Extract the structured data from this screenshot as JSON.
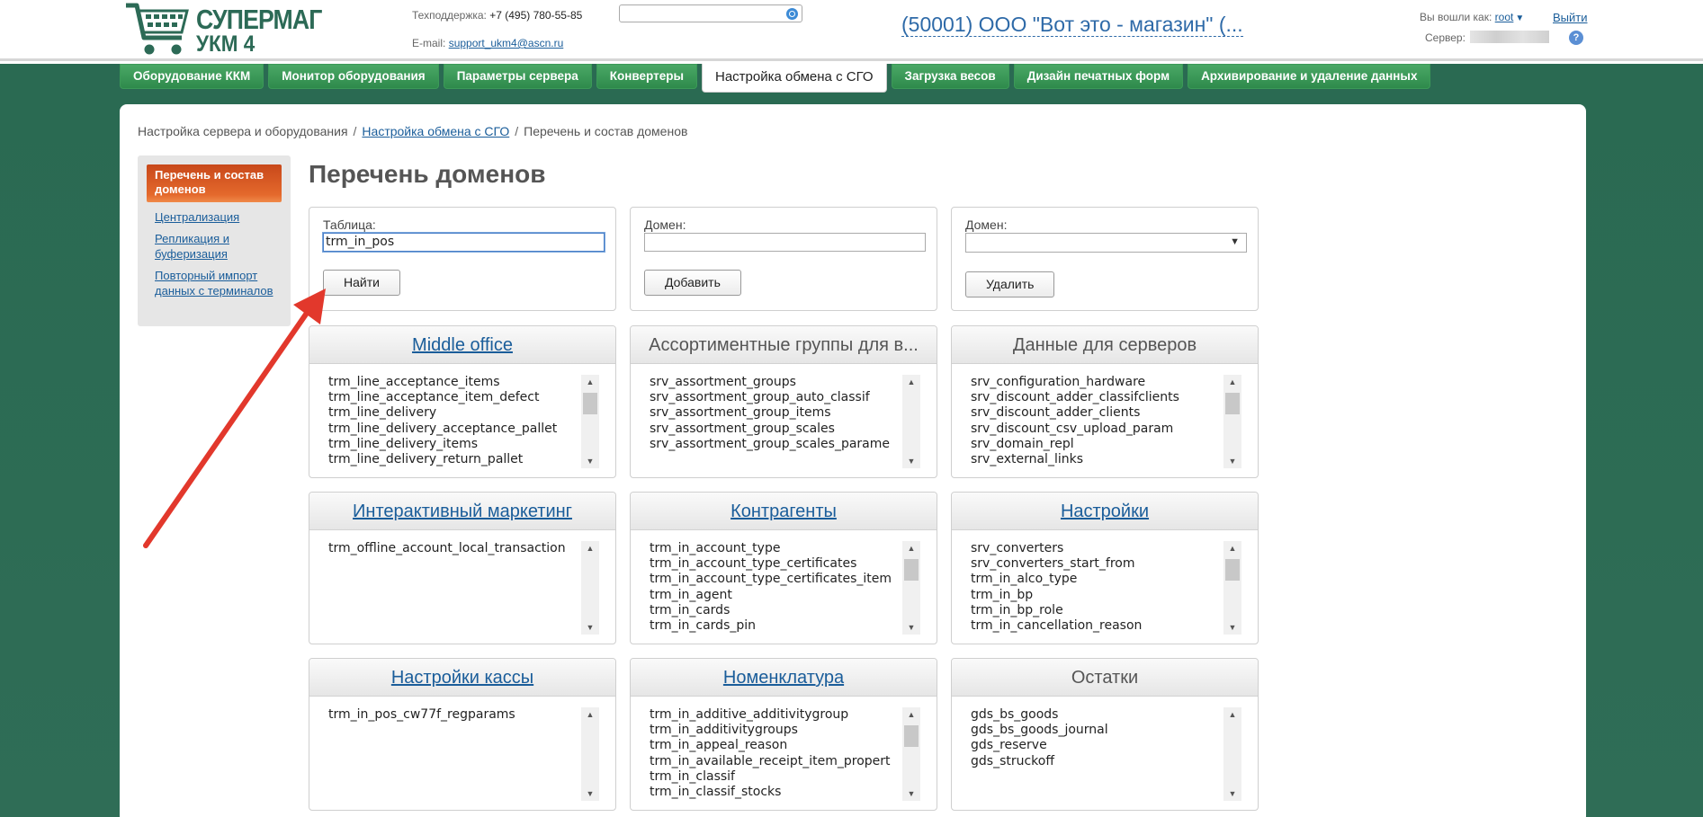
{
  "header": {
    "logo_line1": "СУПЕРМАГ",
    "logo_line2": "УКМ 4",
    "support_label": "Техподдержка:",
    "support_phone": "+7 (495) 780-55-85",
    "email_label": "E-mail:",
    "email": "support_ukm4@ascn.ru",
    "search_value": "",
    "shop_title": "(50001) ООО \"Вот это - магазин\" (...",
    "login_label": "Вы вошли как:",
    "login_user": "root",
    "logout": "Выйти",
    "server_label": "Сервер:",
    "help": "?"
  },
  "tabs": [
    {
      "label": "Оборудование ККМ",
      "active": false
    },
    {
      "label": "Монитор оборудования",
      "active": false
    },
    {
      "label": "Параметры сервера",
      "active": false
    },
    {
      "label": "Конвертеры",
      "active": false
    },
    {
      "label": "Настройка обмена с СГО",
      "active": true
    },
    {
      "label": "Загрузка весов",
      "active": false
    },
    {
      "label": "Дизайн печатных форм",
      "active": false
    },
    {
      "label": "Архивирование и удаление данных",
      "active": false
    }
  ],
  "breadcrumb": {
    "item1": "Настройка сервера и оборудования",
    "item2": "Настройка обмена с СГО",
    "item3": "Перечень и состав доменов",
    "sep": "/"
  },
  "sidebar": {
    "active": "Перечень и состав доменов",
    "links": [
      "Централизация",
      "Репликация и буферизация",
      "Повторный импорт данных с терминалов"
    ]
  },
  "page_title": "Перечень доменов",
  "forms": {
    "find": {
      "label": "Таблица:",
      "value": "trm_in_pos",
      "button": "Найти"
    },
    "add": {
      "label": "Домен:",
      "value": "",
      "button": "Добавить"
    },
    "delete": {
      "label": "Домен:",
      "selected": "",
      "button": "Удалить"
    }
  },
  "domains": [
    {
      "title": "Middle office",
      "link": true,
      "items": [
        "trm_line_acceptance_items",
        "trm_line_acceptance_item_defect",
        "trm_line_delivery",
        "trm_line_delivery_acceptance_pallet",
        "trm_line_delivery_items",
        "trm_line_delivery_return_pallet"
      ],
      "thumb": true
    },
    {
      "title": "Ассортиментные группы для в...",
      "link": false,
      "items": [
        "srv_assortment_groups",
        "srv_assortment_group_auto_classif",
        "srv_assortment_group_items",
        "srv_assortment_group_scales",
        "srv_assortment_group_scales_parame"
      ],
      "thumb": false
    },
    {
      "title": "Данные для серверов",
      "link": false,
      "items": [
        "srv_configuration_hardware",
        "srv_discount_adder_classifclients",
        "srv_discount_adder_clients",
        "srv_discount_csv_upload_param",
        "srv_domain_repl",
        "srv_external_links"
      ],
      "thumb": true
    },
    {
      "title": "Интерактивный маркетинг",
      "link": true,
      "items": [
        "trm_offline_account_local_transaction"
      ],
      "thumb": false
    },
    {
      "title": "Контрагенты",
      "link": true,
      "items": [
        "trm_in_account_type",
        "trm_in_account_type_certificates",
        "trm_in_account_type_certificates_item",
        "trm_in_agent",
        "trm_in_cards",
        "trm_in_cards_pin"
      ],
      "thumb": true
    },
    {
      "title": "Настройки",
      "link": true,
      "items": [
        "srv_converters",
        "srv_converters_start_from",
        "trm_in_alco_type",
        "trm_in_bp",
        "trm_in_bp_role",
        "trm_in_cancellation_reason"
      ],
      "thumb": true
    },
    {
      "title": "Настройки кассы",
      "link": true,
      "items": [
        "trm_in_pos_cw77f_regparams"
      ],
      "thumb": false
    },
    {
      "title": "Номенклатура",
      "link": true,
      "items": [
        "trm_in_additive_additivitygroup",
        "trm_in_additivitygroups",
        "trm_in_appeal_reason",
        "trm_in_available_receipt_item_propert",
        "trm_in_classif",
        "trm_in_classif_stocks"
      ],
      "thumb": true
    },
    {
      "title": "Остатки",
      "link": false,
      "items": [
        "gds_bs_goods",
        "gds_bs_goods_journal",
        "gds_reserve",
        "gds_struckoff"
      ],
      "thumb": false
    }
  ],
  "colors": {
    "brand_green": "#2c6a56",
    "tab_green": "#3a9a56",
    "active_orange": "#e4692c",
    "link_blue": "#1a5d9a",
    "arrow_red": "#e2382c"
  }
}
